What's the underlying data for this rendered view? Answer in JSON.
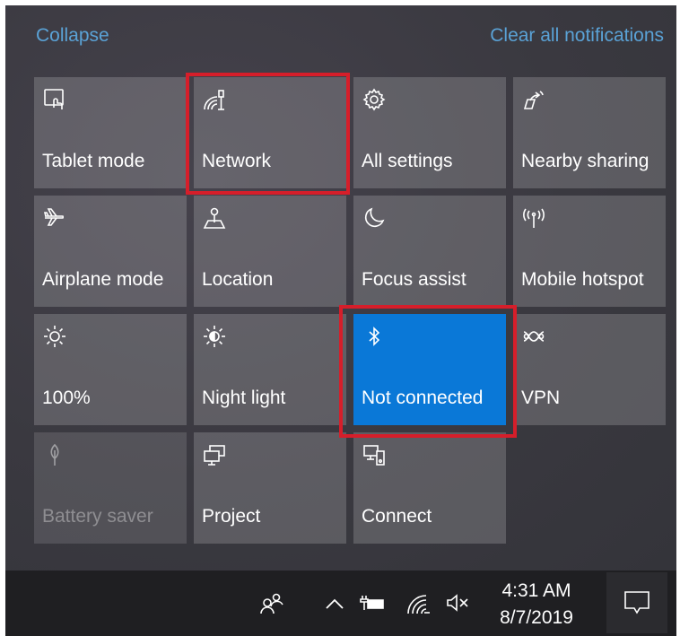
{
  "header": {
    "collapse_label": "Collapse",
    "clear_label": "Clear all notifications"
  },
  "tiles": [
    {
      "label": "Tablet mode",
      "icon": "tablet-mode-icon"
    },
    {
      "label": "Network",
      "icon": "network-icon"
    },
    {
      "label": "All settings",
      "icon": "gear-icon"
    },
    {
      "label": "Nearby sharing",
      "icon": "nearby-sharing-icon"
    },
    {
      "label": "Airplane mode",
      "icon": "airplane-icon"
    },
    {
      "label": "Location",
      "icon": "location-icon"
    },
    {
      "label": "Focus assist",
      "icon": "moon-icon"
    },
    {
      "label": "Mobile hotspot",
      "icon": "hotspot-icon"
    },
    {
      "label": "100%",
      "icon": "brightness-icon"
    },
    {
      "label": "Night light",
      "icon": "night-light-icon"
    },
    {
      "label": "Not connected",
      "icon": "bluetooth-icon",
      "active": true
    },
    {
      "label": "VPN",
      "icon": "vpn-icon"
    },
    {
      "label": "Battery saver",
      "icon": "battery-saver-icon",
      "disabled": true
    },
    {
      "label": "Project",
      "icon": "project-icon"
    },
    {
      "label": "Connect",
      "icon": "connect-icon"
    }
  ],
  "taskbar": {
    "time": "4:31 AM",
    "date": "8/7/2019",
    "icons": [
      "people-icon",
      "chevron-up-icon",
      "battery-icon",
      "wifi-icon",
      "volume-muted-icon"
    ]
  },
  "colors": {
    "accent": "#0a78d7",
    "link": "#5aa2d6",
    "highlight": "#d61e2a"
  }
}
